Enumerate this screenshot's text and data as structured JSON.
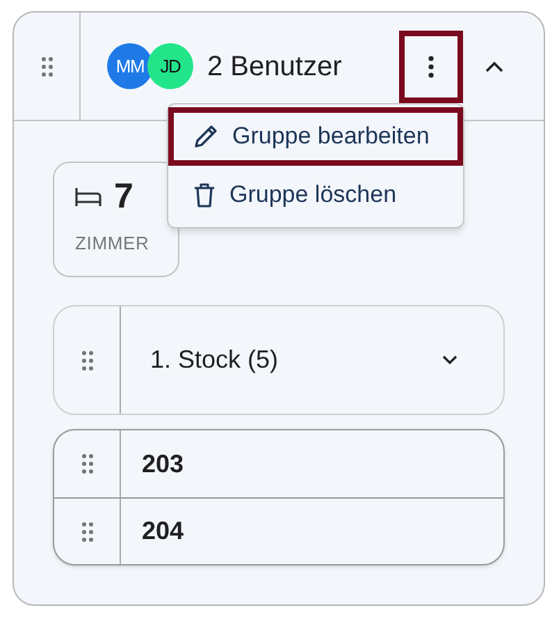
{
  "header": {
    "avatars": [
      {
        "initials": "MM",
        "color": "#1f7ae8"
      },
      {
        "initials": "JD",
        "color": "#22e58a"
      }
    ],
    "title": "2 Benutzer",
    "more_button": {
      "highlighted": true
    },
    "expanded": true
  },
  "menu": {
    "items": [
      {
        "kind": "edit",
        "label": "Gruppe bearbeiten",
        "highlighted": true
      },
      {
        "kind": "delete",
        "label": "Gruppe löschen",
        "highlighted": false
      }
    ]
  },
  "stat": {
    "value": "7",
    "label": "ZIMMER"
  },
  "floor": {
    "title": "1. Stock (5)",
    "expanded": false
  },
  "rooms": [
    {
      "number": "203"
    },
    {
      "number": "204"
    }
  ]
}
